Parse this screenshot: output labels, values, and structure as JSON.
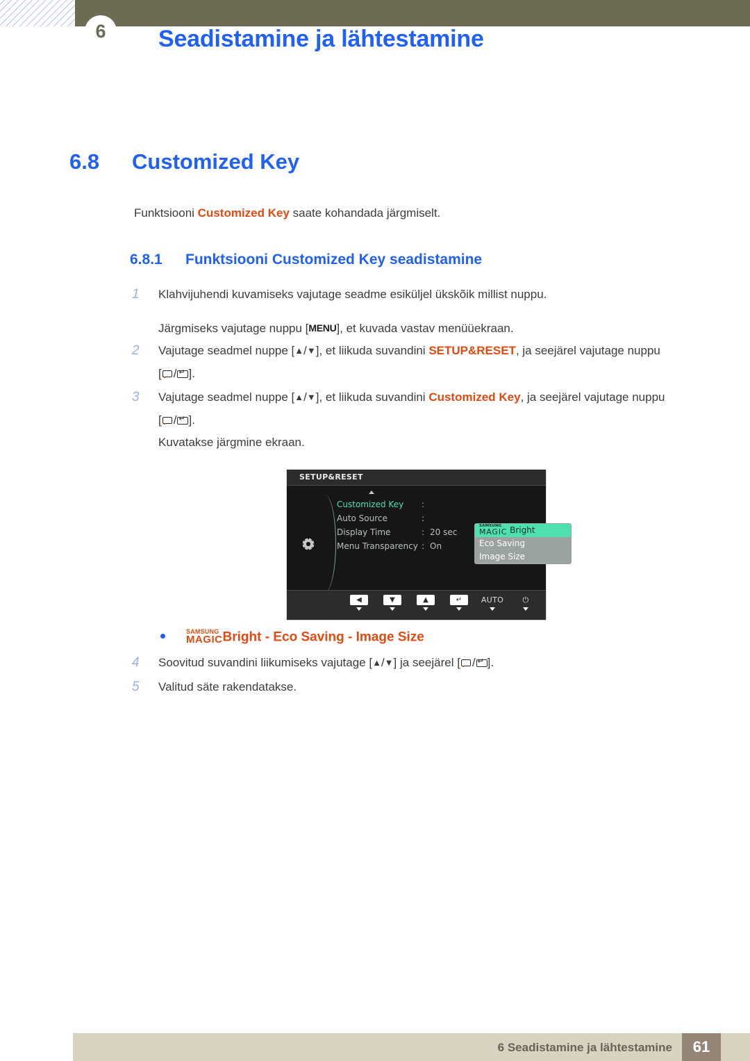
{
  "header": {
    "chapter_number": "6",
    "title": "Seadistamine ja lähtestamine"
  },
  "section": {
    "number": "6.8",
    "title": "Customized Key",
    "intro_prefix": "Funktsiooni ",
    "intro_keyword": "Customized Key",
    "intro_suffix": " saate kohandada järgmiselt."
  },
  "subsection": {
    "number": "6.8.1",
    "title": "Funktsiooni Customized Key seadistamine"
  },
  "steps": {
    "s1_num": "1",
    "s1_text": "Klahvijuhendi kuvamiseks vajutage seadme esiküljel ükskõik millist nuppu.",
    "s1_sub_a": "Järgmiseks vajutage nuppu [",
    "s1_menu_key": "MENU",
    "s1_sub_b": "], et kuvada vastav menüüekraan.",
    "s2_num": "2",
    "s2_a": "Vajutage seadmel nuppe [",
    "s2_up": "▲",
    "s2_slash": "/",
    "s2_down": "▼",
    "s2_b": "], et liikuda suvandini ",
    "s2_kw": "SETUP&RESET",
    "s2_c": ", ja seejärel vajutage nuppu",
    "s2_d_open": "[",
    "s2_d_close": "].",
    "s3_num": "3",
    "s3_a": "Vajutage seadmel nuppe [",
    "s3_b": "], et liikuda suvandini ",
    "s3_kw": "Customized Key",
    "s3_c": ", ja seejärel vajutage nuppu",
    "s3_d_open": "[",
    "s3_d_close": "].",
    "s3_sub": "Kuvatakse järgmine ekraan.",
    "s4_num": "4",
    "s4_a": "Soovitud suvandini liikumiseks vajutage [",
    "s4_b": "] ja seejärel [",
    "s4_c": "].",
    "s5_num": "5",
    "s5_text": "Valitud säte rakendatakse."
  },
  "bullet": {
    "magic_top": "SAMSUNG",
    "magic_bottom": "MAGIC",
    "option_1": "Bright",
    "sep_1": " - ",
    "option_2": "Eco Saving",
    "sep_2": " - ",
    "option_3": "Image Size"
  },
  "osd": {
    "title": "SETUP&RESET",
    "rows": [
      {
        "label": "Customized Key",
        "colon": ":",
        "value": "",
        "selected": true
      },
      {
        "label": "Auto Source",
        "colon": ":",
        "value": "",
        "selected": false
      },
      {
        "label": "Display Time",
        "colon": ":",
        "value": "20 sec",
        "selected": false
      },
      {
        "label": "Menu Transparency",
        "colon": ":",
        "value": "On",
        "selected": false
      }
    ],
    "dropdown": {
      "magic_top": "SAMSUNG",
      "magic_bottom": "MAGIC",
      "opt_1_suffix": "Bright",
      "opt_2": "Eco Saving",
      "opt_3": "Image Size"
    },
    "buttons": [
      {
        "glyph": "◀",
        "name": "left"
      },
      {
        "glyph": "▼",
        "name": "down"
      },
      {
        "glyph": "▲",
        "name": "up"
      },
      {
        "glyph": "↵",
        "name": "enter"
      },
      {
        "glyph": "AUTO",
        "name": "auto"
      },
      {
        "glyph": "⏻",
        "name": "power"
      }
    ]
  },
  "footer": {
    "text": "6 Seadistamine ja lähtestamine",
    "page": "61"
  },
  "colors": {
    "heading_blue": "#2160f4",
    "keyword_orange": "#e14a10",
    "header_band": "#6e6b54",
    "footer_bar": "#d8d2c0",
    "footer_page_box": "#948577",
    "osd_highlight": "#4ee0ae"
  }
}
